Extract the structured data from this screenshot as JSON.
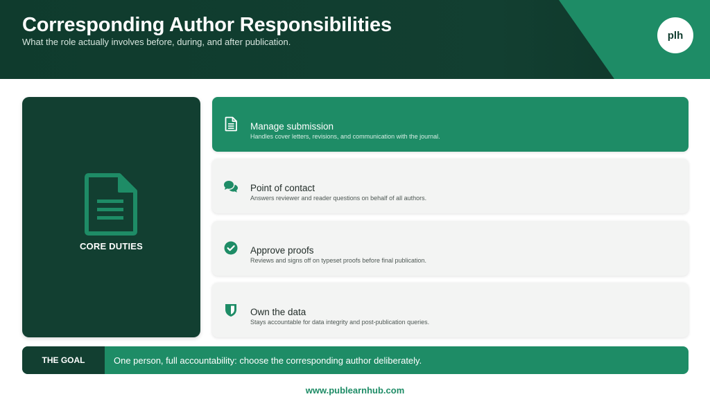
{
  "header": {
    "title": "Corresponding Author Responsibilities",
    "subtitle": "What the role actually involves before, during, and after publication.",
    "logo": "plh"
  },
  "core": {
    "icon": "document-icon",
    "label": "CORE DUTIES"
  },
  "cards": [
    {
      "icon": "document-icon",
      "title": "Manage submission",
      "desc": "Handles cover letters, revisions, and communication with the journal.",
      "active": true
    },
    {
      "icon": "chat-bubbles-icon",
      "title": "Point of contact",
      "desc": "Answers reviewer and reader questions on behalf of all authors.",
      "active": false
    },
    {
      "icon": "check-circle-icon",
      "title": "Approve proofs",
      "desc": "Reviews and signs off on typeset proofs before final publication.",
      "active": false
    },
    {
      "icon": "shield-icon",
      "title": "Own the data",
      "desc": "Stays accountable for data integrity and post-publication queries.",
      "active": false
    }
  ],
  "goal": {
    "label": "THE GOAL",
    "text": "One person, full accountability: choose the corresponding author deliberately."
  },
  "footer": "www.publearnhub.com",
  "colors": {
    "dark_green": "#123f31",
    "accent_green": "#1e8c66",
    "card_bg": "#f3f4f3"
  }
}
